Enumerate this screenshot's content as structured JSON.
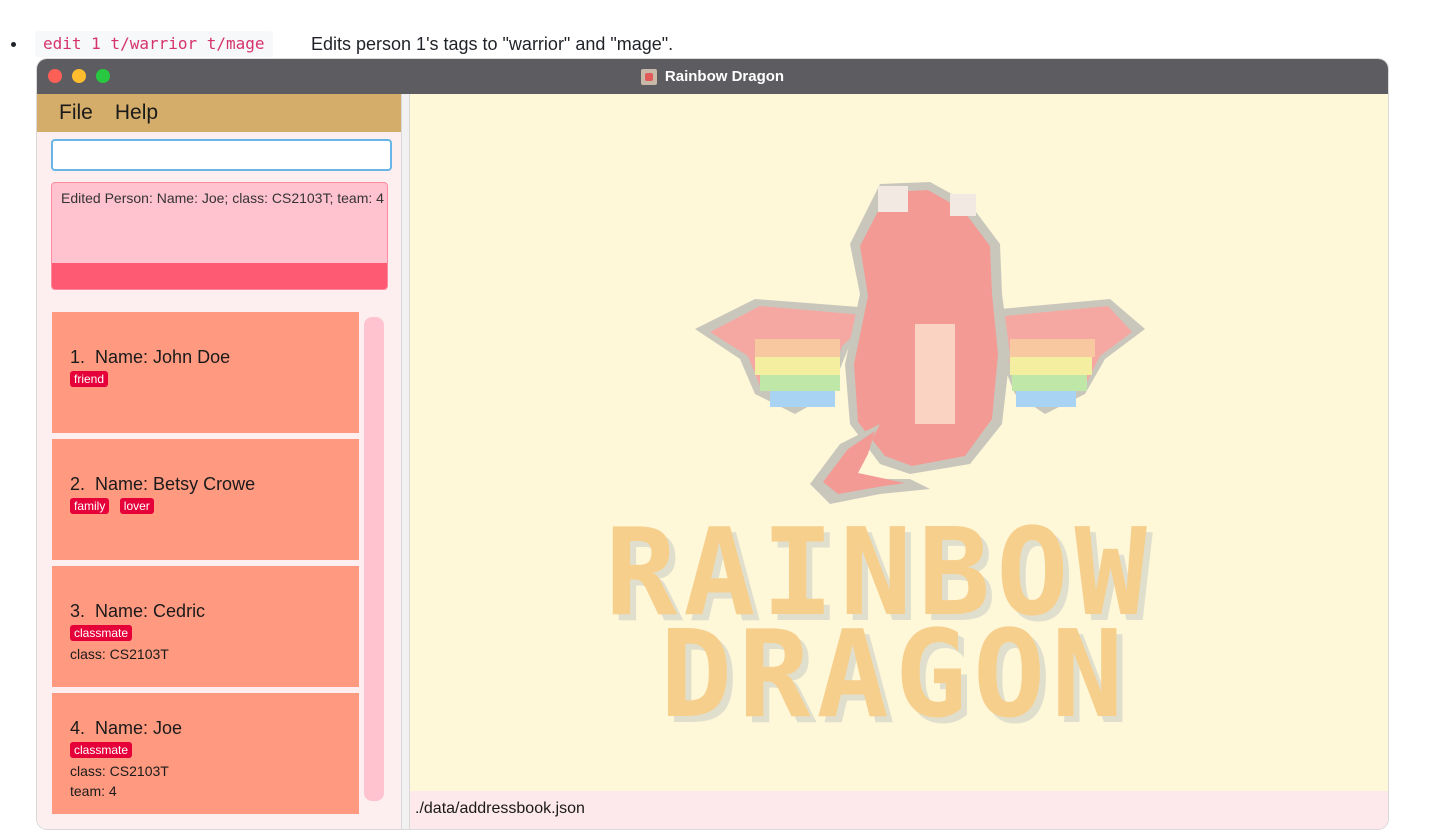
{
  "doc": {
    "command": "edit 1 t/warrior t/mage",
    "description": "Edits person 1's tags to \"warrior\" and \"mage\"."
  },
  "window": {
    "title": "Rainbow Dragon",
    "icon": "dragon-app-icon"
  },
  "menu": {
    "file": "File",
    "help": "Help"
  },
  "command_box": {
    "value": ""
  },
  "result": {
    "text": "Edited Person: Name: Joe; class: CS2103T; team: 4"
  },
  "persons": [
    {
      "index": "1.",
      "name": "Name: John Doe",
      "tags": [
        "friend"
      ],
      "lines": []
    },
    {
      "index": "2.",
      "name": "Name: Betsy Crowe",
      "tags": [
        "family",
        "lover"
      ],
      "lines": []
    },
    {
      "index": "3.",
      "name": "Name: Cedric",
      "tags": [
        "classmate"
      ],
      "lines": [
        "class: CS2103T"
      ]
    },
    {
      "index": "4.",
      "name": "Name: Joe",
      "tags": [
        "classmate"
      ],
      "lines": [
        "class: CS2103T",
        "team: 4"
      ]
    }
  ],
  "logo": {
    "line1": "RAINBOW",
    "line2": "DRAGON"
  },
  "status": {
    "path": "./data/addressbook.json"
  },
  "colors": {
    "menubar": "#d4ad6a",
    "card": "#ff9a80",
    "tag": "#e6003a",
    "result_bg": "#ffc3d0",
    "result_bar": "#ff5a74",
    "canvas": "#fef7d8"
  }
}
